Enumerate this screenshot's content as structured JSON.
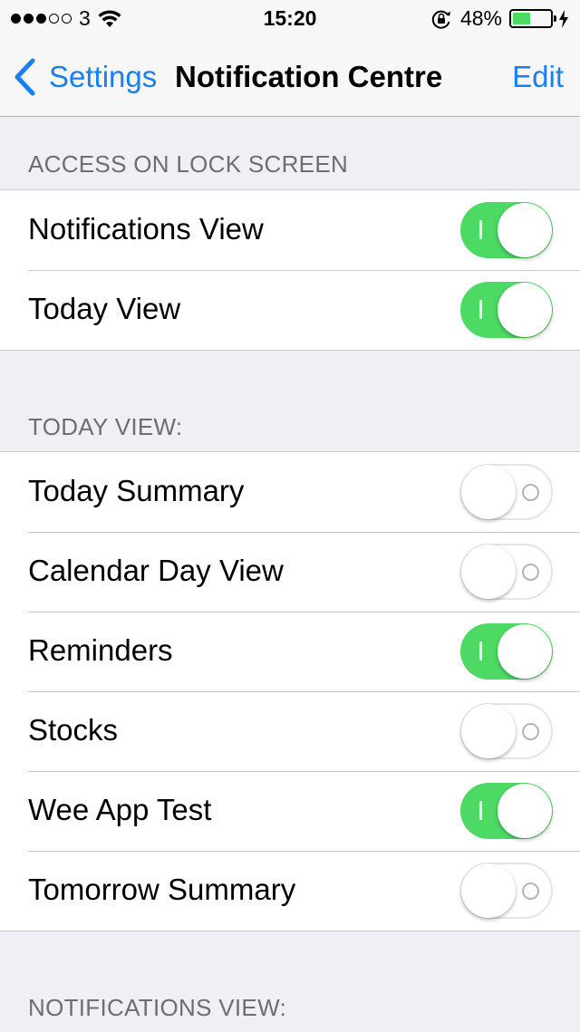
{
  "status_bar": {
    "signal_dots": [
      true,
      true,
      true,
      false,
      false
    ],
    "carrier": "3",
    "time": "15:20",
    "battery_percent": "48%",
    "battery_level": 0.48,
    "battery_color": "#4cd964"
  },
  "nav": {
    "back_label": "Settings",
    "title": "Notification Centre",
    "edit_label": "Edit",
    "accent": "#1a7ff5"
  },
  "sections": [
    {
      "header": "ACCESS ON LOCK SCREEN",
      "rows": [
        {
          "label": "Notifications View",
          "on": true
        },
        {
          "label": "Today View",
          "on": true
        }
      ]
    },
    {
      "header": "TODAY VIEW:",
      "rows": [
        {
          "label": "Today Summary",
          "on": false
        },
        {
          "label": "Calendar Day View",
          "on": false
        },
        {
          "label": "Reminders",
          "on": true
        },
        {
          "label": "Stocks",
          "on": false
        },
        {
          "label": "Wee App Test",
          "on": true
        },
        {
          "label": "Tomorrow Summary",
          "on": false
        }
      ]
    },
    {
      "header": "NOTIFICATIONS VIEW:",
      "rows": []
    }
  ]
}
